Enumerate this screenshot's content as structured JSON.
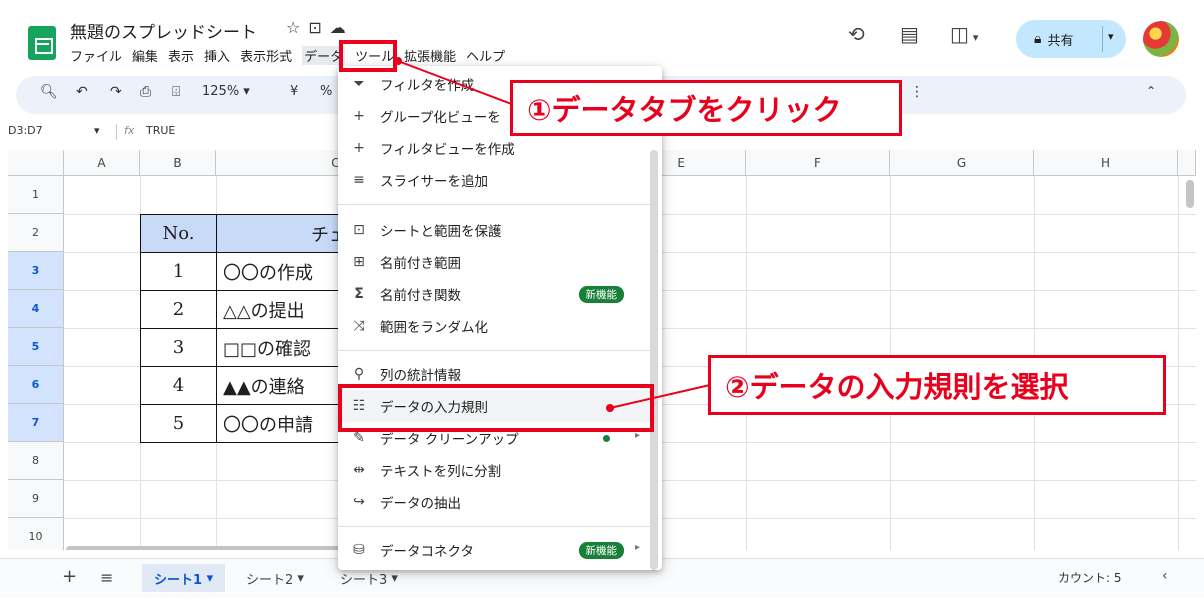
{
  "app": {
    "doc_title": "無題のスプレッドシート",
    "title_icons": [
      "star-icon",
      "move-to-folder-icon",
      "cloud-status-icon"
    ]
  },
  "menubar": [
    "ファイル",
    "編集",
    "表示",
    "挿入",
    "表示形式",
    "データ",
    "ツール",
    "拡張機能",
    "ヘルプ"
  ],
  "header_right": {
    "history_icon": "history-icon",
    "comments_icon": "comment-icon",
    "meet_icon": "meet-camera-icon",
    "share_label": "共有"
  },
  "toolbar": {
    "zoom": "125%",
    "currency": "¥",
    "percent": "%",
    "more": "⋮"
  },
  "formula_bar": {
    "name_box": "D3:D7",
    "fx": "fx",
    "value": "TRUE"
  },
  "grid": {
    "columns": [
      "A",
      "B",
      "C",
      "E",
      "F",
      "G",
      "H"
    ],
    "rows": [
      "1",
      "2",
      "3",
      "4",
      "5",
      "6",
      "7",
      "8",
      "9",
      "10"
    ],
    "table_header": {
      "no": "No.",
      "check": "チェッ"
    },
    "table_rows": [
      {
        "no": "1",
        "task": "〇〇の作成"
      },
      {
        "no": "2",
        "task": "△△の提出"
      },
      {
        "no": "3",
        "task": "□□の確認"
      },
      {
        "no": "4",
        "task": "▲▲の連絡"
      },
      {
        "no": "5",
        "task": "〇〇の申請"
      }
    ]
  },
  "data_menu": {
    "items": [
      {
        "icon": "filter-icon",
        "label": "フィルタを作成"
      },
      {
        "icon": "plus-icon",
        "label": "グループ化ビューを"
      },
      {
        "icon": "plus-icon",
        "label": "フィルタビューを作成"
      },
      {
        "icon": "slicer-icon",
        "label": "スライサーを追加"
      },
      {
        "icon": "lock-icon",
        "label": "シートと範囲を保護"
      },
      {
        "icon": "named-range-icon",
        "label": "名前付き範囲"
      },
      {
        "icon": "sigma-icon",
        "label": "名前付き関数",
        "badge": "新機能"
      },
      {
        "icon": "shuffle-icon",
        "label": "範囲をランダム化"
      },
      {
        "icon": "lightbulb-icon",
        "label": "列の統計情報"
      },
      {
        "icon": "data-validation-icon",
        "label": "データの入力規則"
      },
      {
        "icon": "cleanup-icon",
        "label": "データ クリーンアップ"
      },
      {
        "icon": "split-icon",
        "label": "テキストを列に分割"
      },
      {
        "icon": "extract-icon",
        "label": "データの抽出"
      },
      {
        "icon": "database-icon",
        "label": "データコネクタ",
        "badge": "新機能"
      }
    ]
  },
  "sheets": {
    "tabs": [
      "シート1",
      "シート2",
      "シート3"
    ],
    "status": "カウント: 5"
  },
  "annotations": {
    "step1": "①データタブをクリック",
    "step2": "②データの入力規則を選択",
    "color": "#e8001c"
  }
}
